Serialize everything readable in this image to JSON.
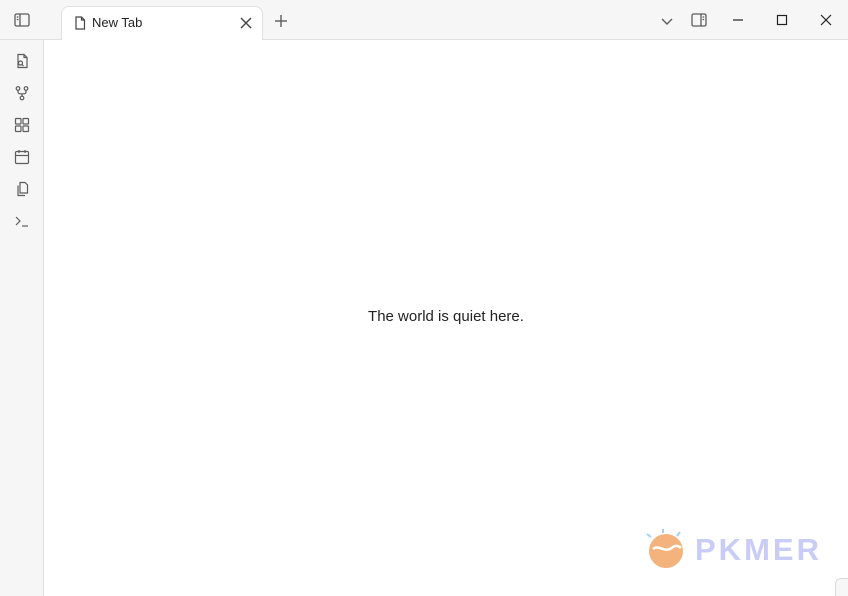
{
  "tabs": [
    {
      "title": "New Tab",
      "icon": "file-icon"
    }
  ],
  "main": {
    "empty_message": "The world is quiet here."
  },
  "ribbon": {
    "items": [
      {
        "name": "open-quick-switcher",
        "icon": "file-search-icon"
      },
      {
        "name": "open-graph-view",
        "icon": "git-fork-icon"
      },
      {
        "name": "open-canvas",
        "icon": "layout-grid-icon"
      },
      {
        "name": "open-daily-note",
        "icon": "calendar-icon"
      },
      {
        "name": "insert-template",
        "icon": "files-icon"
      },
      {
        "name": "open-command-palette",
        "icon": "terminal-icon"
      }
    ]
  },
  "watermark": {
    "text": "PKMER"
  },
  "colors": {
    "chrome_bg": "#f6f6f6",
    "border": "#e0e0e0",
    "icon": "#5c5c5c",
    "watermark": "#c9cdf6",
    "logo_orange": "#f4b37c"
  }
}
